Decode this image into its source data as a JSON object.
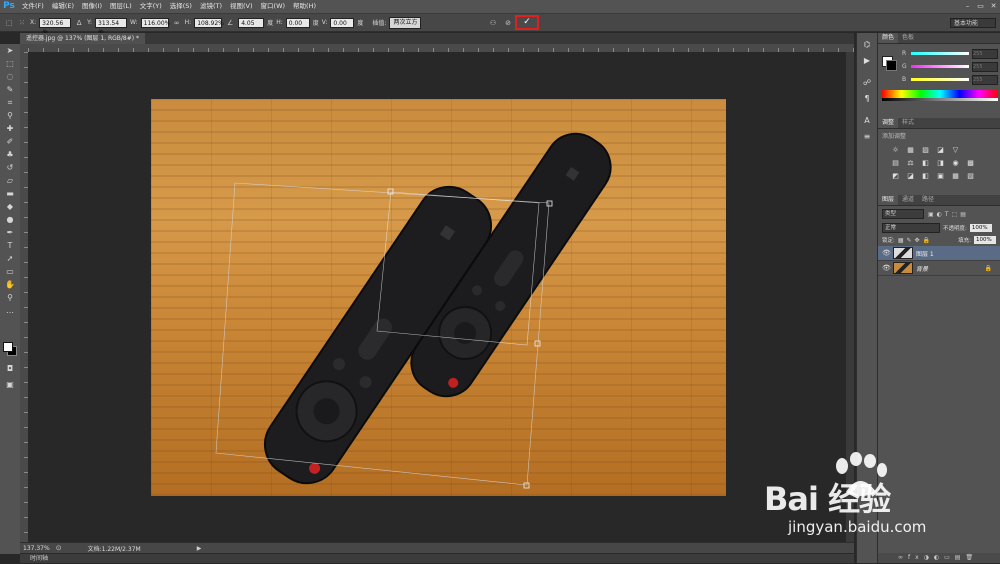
{
  "menubar": {
    "logo": "Ps",
    "items": [
      "文件(F)",
      "编辑(E)",
      "图像(I)",
      "图层(L)",
      "文字(Y)",
      "选择(S)",
      "滤镜(T)",
      "视图(V)",
      "窗口(W)",
      "帮助(H)"
    ],
    "window_controls": [
      "–",
      "▭",
      "✕"
    ]
  },
  "options": {
    "x_label": "X:",
    "x_value": "320.56 像",
    "y_label": "Y:",
    "y_value": "313.54 像",
    "w_label": "W:",
    "w_value": "116.00%",
    "h_label": "H:",
    "h_value": "108.92%",
    "angle_value": "4.05",
    "angle_unit": "度",
    "hskew_label": "H:",
    "hskew_value": "0.00",
    "vskew_label": "V:",
    "vskew_value": "0.00",
    "skew_unit": "度",
    "interp_label": "插值:",
    "interp_value": "两次立方",
    "commit_symbol": "✓",
    "cancel_symbol": "⊘",
    "workspace": "基本功能"
  },
  "document": {
    "tab_title": "遥控器.jpg @ 137% (图层 1, RGB/8#) *",
    "zoom": "137.37%",
    "doc_info": "文档:1.22M/2.37M",
    "timeline_label": "时间轴"
  },
  "panels": {
    "color_tabs": [
      "颜色",
      "色板"
    ],
    "color_sliders": [
      {
        "label": "R",
        "value": "255",
        "gradient": "linear-gradient(90deg,#2ff,#fff)"
      },
      {
        "label": "G",
        "value": "255",
        "gradient": "linear-gradient(90deg,#f2f,#fff)"
      },
      {
        "label": "B",
        "value": "255",
        "gradient": "linear-gradient(90deg,#ff2,#fff)"
      }
    ],
    "adjust_tabs": [
      "调整",
      "样式"
    ],
    "adjust_title": "添加调整",
    "adjust_icons": [
      "☼",
      "▦",
      "▨",
      "◪",
      "▽",
      "",
      "",
      "▤",
      "⚖",
      "◧",
      "◨",
      "◉",
      "▩",
      "",
      "◩",
      "◪",
      "◧",
      "▣",
      "▦",
      "▧",
      ""
    ],
    "layers_tabs": [
      "图层",
      "通道",
      "路径"
    ],
    "filter_kind": "类型",
    "blend_mode": "正常",
    "opacity_label": "不透明度:",
    "opacity_value": "100%",
    "lock_label": "锁定:",
    "fill_label": "填充:",
    "fill_value": "100%",
    "layers": [
      {
        "name": "图层 1"
      },
      {
        "name": "背景"
      }
    ]
  },
  "watermark": {
    "brand": "Bai   经验",
    "url": "jingyan.baidu.com"
  },
  "colors": {
    "accent_red": "#e02020",
    "ps_blue": "#31a8ff",
    "selected_layer": "#5a6b86"
  }
}
